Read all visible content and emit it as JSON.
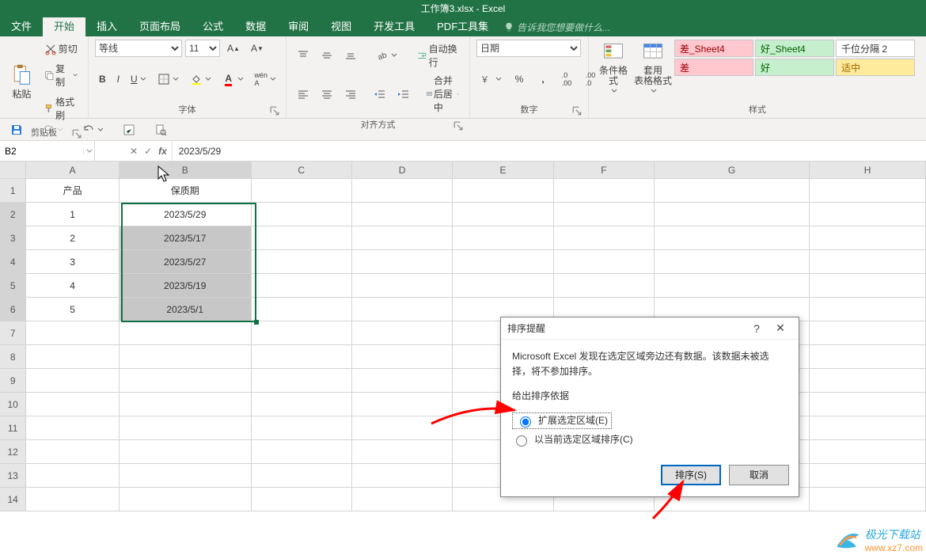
{
  "window": {
    "title": "工作簿3.xlsx - Excel"
  },
  "tabs": {
    "file": "文件",
    "home": "开始",
    "insert": "插入",
    "layout": "页面布局",
    "formula": "公式",
    "data": "数据",
    "review": "审阅",
    "view": "视图",
    "dev": "开发工具",
    "pdf": "PDF工具集",
    "tell": "告诉我您想要做什么..."
  },
  "clipboard": {
    "paste": "粘贴",
    "cut": "剪切",
    "copy": "复制",
    "painter": "格式刷",
    "group": "剪贴板"
  },
  "font": {
    "name": "等线",
    "size": "11",
    "group": "字体",
    "bold": "B",
    "italic": "I",
    "underline": "U"
  },
  "align": {
    "wrap": "自动换行",
    "merge": "合并后居中",
    "group": "对齐方式"
  },
  "number": {
    "format": "日期",
    "group": "数字"
  },
  "styles": {
    "condfmt": "条件格式",
    "table": "套用\n表格格式",
    "group": "样式",
    "bad": "差_Sheet4",
    "good": "好_Sheet4",
    "thousand": "千位分隔 2",
    "bad2": "差",
    "good2": "好",
    "neutral": "适中"
  },
  "namebox": "B2",
  "formula": "2023/5/29",
  "columns": [
    "A",
    "B",
    "C",
    "D",
    "E",
    "F",
    "G",
    "H"
  ],
  "headers": {
    "A": "产品",
    "B": "保质期"
  },
  "rows": [
    {
      "A": "1",
      "B": "2023/5/29"
    },
    {
      "A": "2",
      "B": "2023/5/17"
    },
    {
      "A": "3",
      "B": "2023/5/27"
    },
    {
      "A": "4",
      "B": "2023/5/19"
    },
    {
      "A": "5",
      "B": "2023/5/1"
    }
  ],
  "dialog": {
    "title": "排序提醒",
    "msg": "Microsoft Excel 发现在选定区域旁边还有数据。该数据未被选择，将不参加排序。",
    "legend": "给出排序依据",
    "opt_expand": "扩展选定区域(E)",
    "opt_current": "以当前选定区域排序(C)",
    "ok": "排序(S)",
    "cancel": "取消",
    "help": "?",
    "close": "✕"
  },
  "watermark": {
    "name": "极光下载站",
    "url": "www.xz7.com"
  }
}
